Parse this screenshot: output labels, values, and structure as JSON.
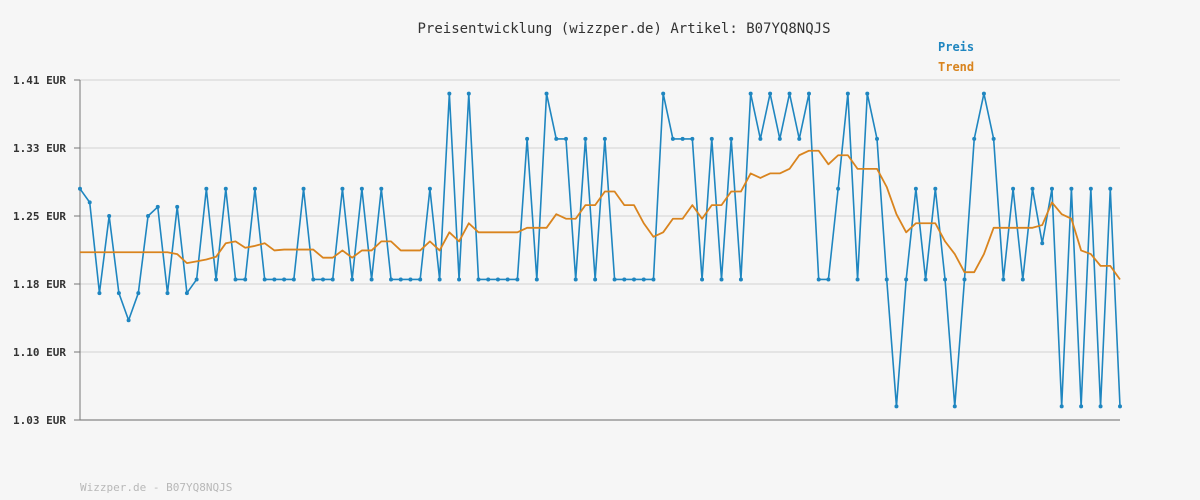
{
  "chart_data": {
    "type": "line",
    "title": "Preisentwicklung (wizzper.de) Artikel: B07YQ8NQJS",
    "footer": "Wizzper.de - B07YQ8NQJS",
    "y_tick_labels": [
      "1.41 EUR",
      "1.33 EUR",
      "1.25 EUR",
      "1.18 EUR",
      "1.10 EUR",
      "1.03 EUR"
    ],
    "y_ticks": [
      1.41,
      1.335,
      1.26,
      1.185,
      1.11,
      1.035
    ],
    "ylim": [
      1.035,
      1.41
    ],
    "grid": true,
    "legend_position": "top-right",
    "colors": {
      "preis": "#1f86c0",
      "trend": "#d9841e",
      "grid": "#dddddd",
      "axis": "#777777"
    },
    "series": [
      {
        "name": "Preis",
        "values": [
          1.29,
          1.275,
          1.175,
          1.26,
          1.175,
          1.145,
          1.175,
          1.26,
          1.27,
          1.175,
          1.27,
          1.175,
          1.19,
          1.29,
          1.19,
          1.29,
          1.19,
          1.19,
          1.29,
          1.19,
          1.19,
          1.19,
          1.19,
          1.29,
          1.19,
          1.19,
          1.19,
          1.29,
          1.19,
          1.29,
          1.19,
          1.29,
          1.19,
          1.19,
          1.19,
          1.19,
          1.29,
          1.19,
          1.395,
          1.19,
          1.395,
          1.19,
          1.19,
          1.19,
          1.19,
          1.19,
          1.345,
          1.19,
          1.395,
          1.345,
          1.345,
          1.19,
          1.345,
          1.19,
          1.345,
          1.19,
          1.19,
          1.19,
          1.19,
          1.19,
          1.395,
          1.345,
          1.345,
          1.345,
          1.19,
          1.345,
          1.19,
          1.345,
          1.19,
          1.395,
          1.345,
          1.395,
          1.345,
          1.395,
          1.345,
          1.395,
          1.19,
          1.19,
          1.29,
          1.395,
          1.19,
          1.395,
          1.345,
          1.19,
          1.05,
          1.19,
          1.29,
          1.19,
          1.29,
          1.19,
          1.05,
          1.19,
          1.345,
          1.395,
          1.345,
          1.19,
          1.29,
          1.19,
          1.29,
          1.23,
          1.29,
          1.05,
          1.29,
          1.05,
          1.29,
          1.05,
          1.29,
          1.05
        ]
      },
      {
        "name": "Trend",
        "values": [
          1.22,
          1.22,
          1.22,
          1.22,
          1.22,
          1.22,
          1.22,
          1.22,
          1.22,
          1.22,
          1.218,
          1.208,
          1.21,
          1.212,
          1.215,
          1.23,
          1.232,
          1.225,
          1.227,
          1.23,
          1.222,
          1.223,
          1.223,
          1.223,
          1.223,
          1.214,
          1.214,
          1.222,
          1.214,
          1.222,
          1.222,
          1.232,
          1.232,
          1.222,
          1.222,
          1.222,
          1.232,
          1.222,
          1.242,
          1.232,
          1.252,
          1.242,
          1.242,
          1.242,
          1.242,
          1.242,
          1.247,
          1.247,
          1.247,
          1.262,
          1.257,
          1.257,
          1.272,
          1.272,
          1.287,
          1.287,
          1.272,
          1.272,
          1.252,
          1.237,
          1.242,
          1.257,
          1.257,
          1.272,
          1.257,
          1.272,
          1.272,
          1.287,
          1.287,
          1.307,
          1.302,
          1.307,
          1.307,
          1.312,
          1.327,
          1.332,
          1.332,
          1.317,
          1.327,
          1.327,
          1.312,
          1.312,
          1.312,
          1.292,
          1.262,
          1.242,
          1.252,
          1.252,
          1.252,
          1.232,
          1.218,
          1.198,
          1.198,
          1.218,
          1.247,
          1.247,
          1.247,
          1.247,
          1.247,
          1.25,
          1.275,
          1.262,
          1.257,
          1.222,
          1.218,
          1.205,
          1.205,
          1.19
        ]
      }
    ]
  }
}
